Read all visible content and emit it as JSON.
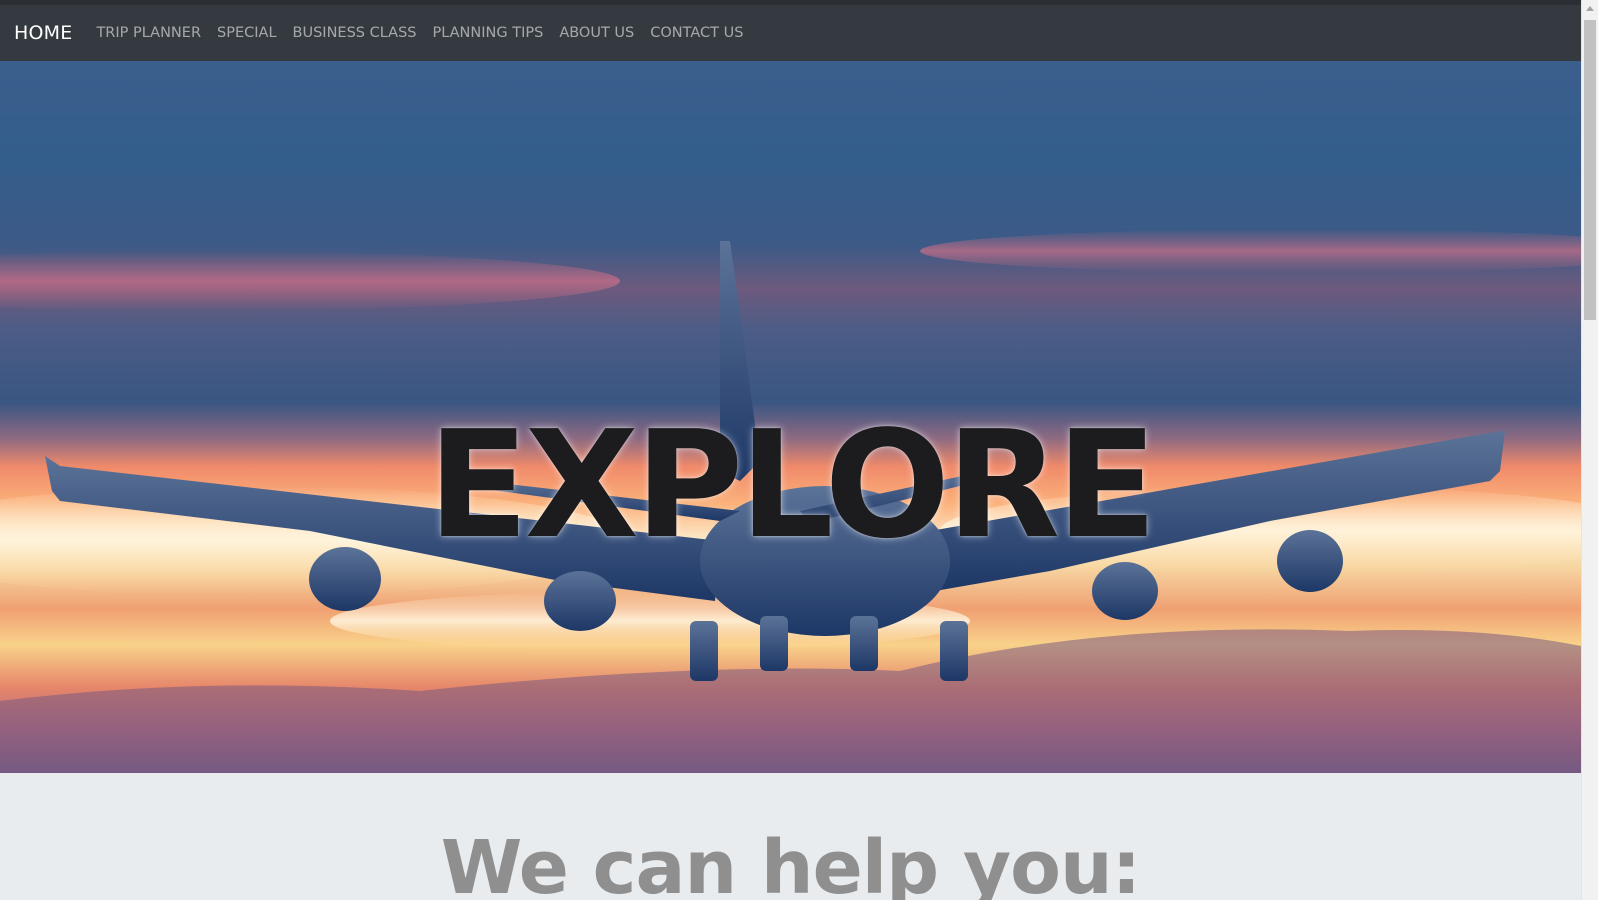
{
  "navbar": {
    "brand": "HOME",
    "items": [
      {
        "label": "TRIP PLANNER"
      },
      {
        "label": "SPECIAL"
      },
      {
        "label": "BUSINESS CLASS"
      },
      {
        "label": "PLANNING TIPS"
      },
      {
        "label": "ABOUT US"
      },
      {
        "label": "CONTACT US"
      }
    ]
  },
  "hero": {
    "title": "EXPLORE",
    "image_subject": "airplane-at-sunset"
  },
  "section": {
    "heading": "We can help you:"
  },
  "colors": {
    "navbar_bg": "#343a40",
    "nav_link": "#a0a3a6",
    "brand": "#ffffff",
    "title": "#1c1c1e",
    "section_bg": "#e9ecef",
    "heading": "#8f8f8f"
  }
}
